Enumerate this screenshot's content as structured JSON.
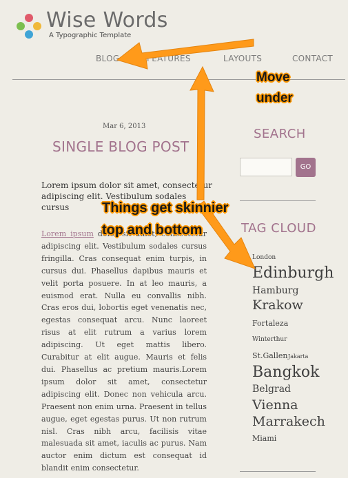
{
  "header": {
    "site_title": "Wise Words",
    "tagline": "A Typographic Template",
    "logo_colors": [
      "#e05a6a",
      "#7cbf4f",
      "#3fa4d6",
      "#f0b83a"
    ]
  },
  "nav": {
    "items": [
      {
        "label": "BLOG"
      },
      {
        "label": "FEATURES"
      },
      {
        "label": "LAYOUTS"
      },
      {
        "label": "CONTACT"
      }
    ]
  },
  "post": {
    "date": "Mar 6, 2013",
    "title": "SINGLE BLOG POST",
    "lead": "Lorem ipsum dolor sit amet, consectetur adipiscing elit. Vestibulum sodales cursus",
    "body_link": "Lorem ipsum",
    "body_text": " dolor sit amet, consectetur adipiscing elit. Vestibulum sodales cursus fringilla. Cras consequat enim turpis, in cursus dui. Phasellus dapibus mauris et velit porta posuere. In at leo mauris, a euismod erat. Nulla eu convallis nibh. Cras eros dui, lobortis eget venenatis nec, egestas consequat arcu. Nunc laoreet risus at elit rutrum a varius lorem adipiscing. Ut eget mattis libero. Curabitur at elit augue. Mauris et felis dui. Phasellus ac pretium mauris.Lorem ipsum dolor sit amet, consectetur adipiscing elit. Donec non vehicula arcu. Praesent non enim urna. Praesent in tellus augue, eget egestas purus. Ut non rutrum nisl. Cras nibh arcu, facilisis vitae malesuada sit amet, iaculis ac purus. Nam auctor enim dictum est consequat id blandit enim consectetur."
  },
  "sidebar": {
    "search_heading": "SEARCH",
    "search_value": "",
    "go_label": "GO",
    "tagcloud_heading": "TAG CLOUD",
    "tags": [
      {
        "label": "London"
      },
      {
        "label": "Edinburgh"
      },
      {
        "label": "Hamburg"
      },
      {
        "label": "Krakow"
      },
      {
        "label": "Fortaleza"
      },
      {
        "label": "Winterthur"
      },
      {
        "label": "St.Gallen"
      },
      {
        "label": "Jakarta"
      },
      {
        "label": "Bangkok"
      },
      {
        "label": "Belgrad"
      },
      {
        "label": "Vienna"
      },
      {
        "label": "Marrakech"
      },
      {
        "label": "Miami"
      }
    ]
  },
  "annotations": {
    "move_under": [
      "Move",
      "under"
    ],
    "skinnier": [
      "Things get skinnier",
      "top and bottom"
    ],
    "arrow_color": "#ff9a1a"
  }
}
